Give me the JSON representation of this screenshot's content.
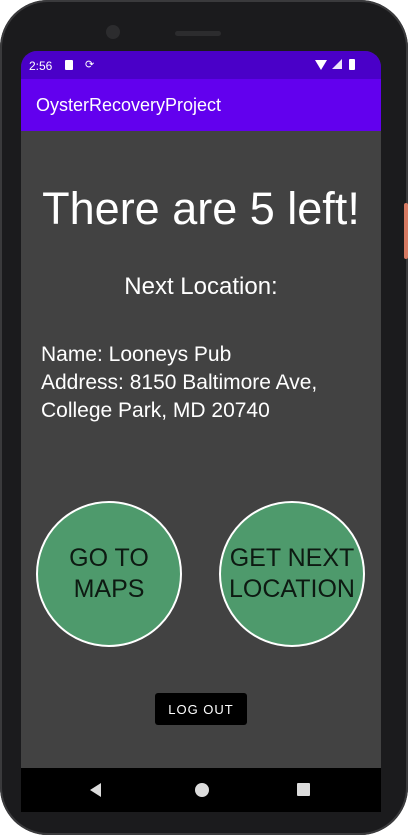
{
  "status_bar": {
    "time": "2:56",
    "icons": [
      "sd-card-icon",
      "sync-icon",
      "wifi-icon",
      "signal-icon",
      "battery-icon"
    ]
  },
  "app_bar": {
    "title": "OysterRecoveryProject",
    "color": "#6200ee"
  },
  "main": {
    "headline": "There are 5 left!",
    "next_label": "Next Location:",
    "location": {
      "name_line": "Name: Looneys Pub",
      "address_line1": "Address: 8150 Baltimore Ave,",
      "address_line2": "College Park, MD 20740"
    }
  },
  "buttons": {
    "maps_line1": "GO TO",
    "maps_line2": "MAPS",
    "next_line1": "GET NEXT",
    "next_line2": "LOCATION",
    "logout": "LOG OUT",
    "circle_color": "#4e9a6c"
  },
  "nav_bar": {
    "icons": [
      "back-icon",
      "home-icon",
      "recents-icon"
    ]
  }
}
